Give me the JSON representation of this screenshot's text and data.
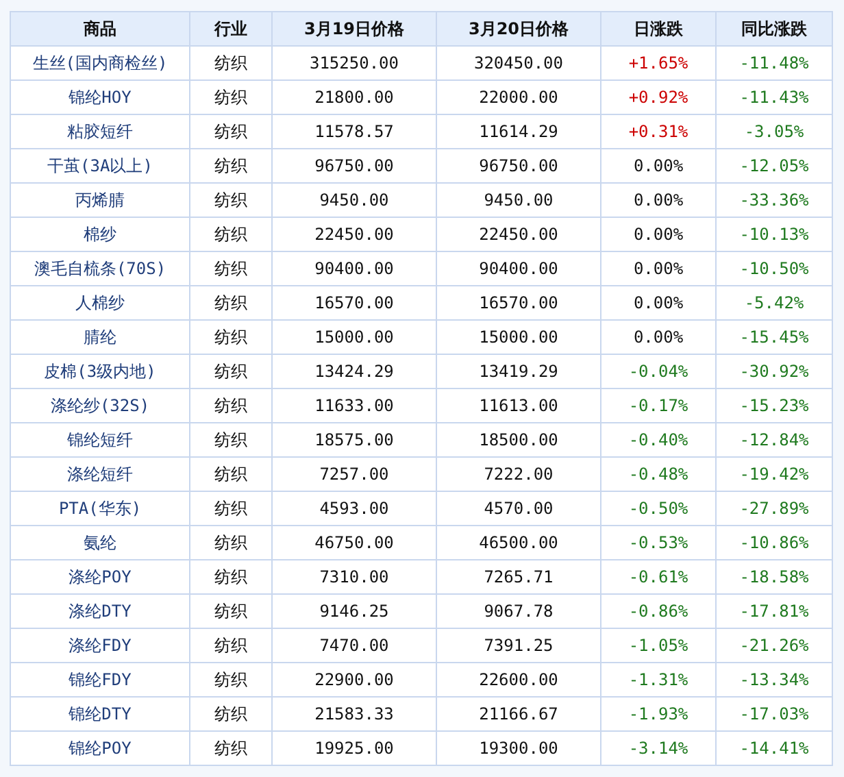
{
  "table": {
    "columns": [
      "商品",
      "行业",
      "3月19日价格",
      "3月20日价格",
      "日涨跌",
      "同比涨跌"
    ],
    "rows": [
      {
        "product": "生丝(国内商检丝)",
        "industry": "纺织",
        "price_0319": "315250.00",
        "price_0320": "320450.00",
        "day_change": {
          "text": "+1.65%",
          "color": "#cc0000"
        },
        "yoy_change": {
          "text": "-11.48%",
          "color": "#1f7a1f"
        }
      },
      {
        "product": "锦纶HOY",
        "industry": "纺织",
        "price_0319": "21800.00",
        "price_0320": "22000.00",
        "day_change": {
          "text": "+0.92%",
          "color": "#cc0000"
        },
        "yoy_change": {
          "text": "-11.43%",
          "color": "#1f7a1f"
        }
      },
      {
        "product": "粘胶短纤",
        "industry": "纺织",
        "price_0319": "11578.57",
        "price_0320": "11614.29",
        "day_change": {
          "text": "+0.31%",
          "color": "#cc0000"
        },
        "yoy_change": {
          "text": "-3.05%",
          "color": "#1f7a1f"
        }
      },
      {
        "product": "干茧(3A以上)",
        "industry": "纺织",
        "price_0319": "96750.00",
        "price_0320": "96750.00",
        "day_change": {
          "text": "0.00%",
          "color": "#111111"
        },
        "yoy_change": {
          "text": "-12.05%",
          "color": "#1f7a1f"
        }
      },
      {
        "product": "丙烯腈",
        "industry": "纺织",
        "price_0319": "9450.00",
        "price_0320": "9450.00",
        "day_change": {
          "text": "0.00%",
          "color": "#111111"
        },
        "yoy_change": {
          "text": "-33.36%",
          "color": "#1f7a1f"
        }
      },
      {
        "product": "棉纱",
        "industry": "纺织",
        "price_0319": "22450.00",
        "price_0320": "22450.00",
        "day_change": {
          "text": "0.00%",
          "color": "#111111"
        },
        "yoy_change": {
          "text": "-10.13%",
          "color": "#1f7a1f"
        }
      },
      {
        "product": "澳毛自梳条(70S)",
        "industry": "纺织",
        "price_0319": "90400.00",
        "price_0320": "90400.00",
        "day_change": {
          "text": "0.00%",
          "color": "#111111"
        },
        "yoy_change": {
          "text": "-10.50%",
          "color": "#1f7a1f"
        }
      },
      {
        "product": "人棉纱",
        "industry": "纺织",
        "price_0319": "16570.00",
        "price_0320": "16570.00",
        "day_change": {
          "text": "0.00%",
          "color": "#111111"
        },
        "yoy_change": {
          "text": "-5.42%",
          "color": "#1f7a1f"
        }
      },
      {
        "product": "腈纶",
        "industry": "纺织",
        "price_0319": "15000.00",
        "price_0320": "15000.00",
        "day_change": {
          "text": "0.00%",
          "color": "#111111"
        },
        "yoy_change": {
          "text": "-15.45%",
          "color": "#1f7a1f"
        }
      },
      {
        "product": "皮棉(3级内地)",
        "industry": "纺织",
        "price_0319": "13424.29",
        "price_0320": "13419.29",
        "day_change": {
          "text": "-0.04%",
          "color": "#1f7a1f"
        },
        "yoy_change": {
          "text": "-30.92%",
          "color": "#1f7a1f"
        }
      },
      {
        "product": "涤纶纱(32S)",
        "industry": "纺织",
        "price_0319": "11633.00",
        "price_0320": "11613.00",
        "day_change": {
          "text": "-0.17%",
          "color": "#1f7a1f"
        },
        "yoy_change": {
          "text": "-15.23%",
          "color": "#1f7a1f"
        }
      },
      {
        "product": "锦纶短纤",
        "industry": "纺织",
        "price_0319": "18575.00",
        "price_0320": "18500.00",
        "day_change": {
          "text": "-0.40%",
          "color": "#1f7a1f"
        },
        "yoy_change": {
          "text": "-12.84%",
          "color": "#1f7a1f"
        }
      },
      {
        "product": "涤纶短纤",
        "industry": "纺织",
        "price_0319": "7257.00",
        "price_0320": "7222.00",
        "day_change": {
          "text": "-0.48%",
          "color": "#1f7a1f"
        },
        "yoy_change": {
          "text": "-19.42%",
          "color": "#1f7a1f"
        }
      },
      {
        "product": "PTA(华东)",
        "industry": "纺织",
        "price_0319": "4593.00",
        "price_0320": "4570.00",
        "day_change": {
          "text": "-0.50%",
          "color": "#1f7a1f"
        },
        "yoy_change": {
          "text": "-27.89%",
          "color": "#1f7a1f"
        }
      },
      {
        "product": "氨纶",
        "industry": "纺织",
        "price_0319": "46750.00",
        "price_0320": "46500.00",
        "day_change": {
          "text": "-0.53%",
          "color": "#1f7a1f"
        },
        "yoy_change": {
          "text": "-10.86%",
          "color": "#1f7a1f"
        }
      },
      {
        "product": "涤纶POY",
        "industry": "纺织",
        "price_0319": "7310.00",
        "price_0320": "7265.71",
        "day_change": {
          "text": "-0.61%",
          "color": "#1f7a1f"
        },
        "yoy_change": {
          "text": "-18.58%",
          "color": "#1f7a1f"
        }
      },
      {
        "product": "涤纶DTY",
        "industry": "纺织",
        "price_0319": "9146.25",
        "price_0320": "9067.78",
        "day_change": {
          "text": "-0.86%",
          "color": "#1f7a1f"
        },
        "yoy_change": {
          "text": "-17.81%",
          "color": "#1f7a1f"
        }
      },
      {
        "product": "涤纶FDY",
        "industry": "纺织",
        "price_0319": "7470.00",
        "price_0320": "7391.25",
        "day_change": {
          "text": "-1.05%",
          "color": "#1f7a1f"
        },
        "yoy_change": {
          "text": "-21.26%",
          "color": "#1f7a1f"
        }
      },
      {
        "product": "锦纶FDY",
        "industry": "纺织",
        "price_0319": "22900.00",
        "price_0320": "22600.00",
        "day_change": {
          "text": "-1.31%",
          "color": "#1f7a1f"
        },
        "yoy_change": {
          "text": "-13.34%",
          "color": "#1f7a1f"
        }
      },
      {
        "product": "锦纶DTY",
        "industry": "纺织",
        "price_0319": "21583.33",
        "price_0320": "21166.67",
        "day_change": {
          "text": "-1.93%",
          "color": "#1f7a1f"
        },
        "yoy_change": {
          "text": "-17.03%",
          "color": "#1f7a1f"
        }
      },
      {
        "product": "锦纶POY",
        "industry": "纺织",
        "price_0319": "19925.00",
        "price_0320": "19300.00",
        "day_change": {
          "text": "-3.14%",
          "color": "#1f7a1f"
        },
        "yoy_change": {
          "text": "-14.41%",
          "color": "#1f7a1f"
        }
      }
    ]
  }
}
